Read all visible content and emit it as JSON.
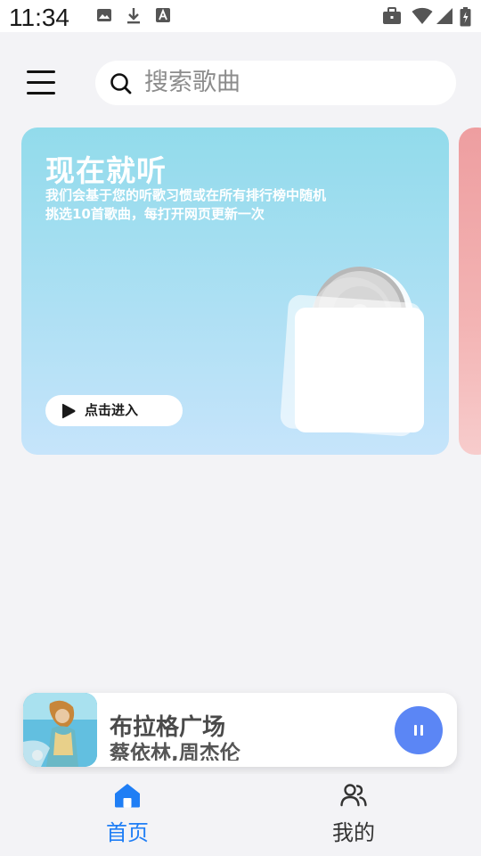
{
  "status_bar": {
    "time": "11:34",
    "icons": [
      "image-icon",
      "download-icon",
      "app-icon",
      "briefcase-icon",
      "wifi-icon",
      "signal-icon",
      "battery-icon"
    ]
  },
  "header": {
    "menu_icon": "hamburger-menu-icon",
    "search": {
      "icon": "search-icon",
      "placeholder": "搜索歌曲"
    }
  },
  "banner": {
    "title": "现在就听",
    "description": "我们会基于您的听歌习惯或在所有排行榜中随机挑选10首歌曲，每打开网页更新一次",
    "button_label": "点击进入",
    "button_icon": "play-icon",
    "art_icon": "cd-case-icon",
    "colors": {
      "gradient_top": "#92dbeb",
      "gradient_bottom": "#c6e4fb",
      "next_card": "#ee9ea0"
    }
  },
  "player": {
    "song_title": "布拉格广场",
    "artist": "蔡依林,周杰伦",
    "cover_icon": "album-cover",
    "state_icon": "pause-icon",
    "accent_color": "#5b86f5"
  },
  "bottom_nav": {
    "items": [
      {
        "label": "首页",
        "icon": "home-icon",
        "active": true
      },
      {
        "label": "我的",
        "icon": "user-group-icon",
        "active": false
      }
    ],
    "active_color": "#1f7ef5",
    "inactive_color": "#333333"
  }
}
